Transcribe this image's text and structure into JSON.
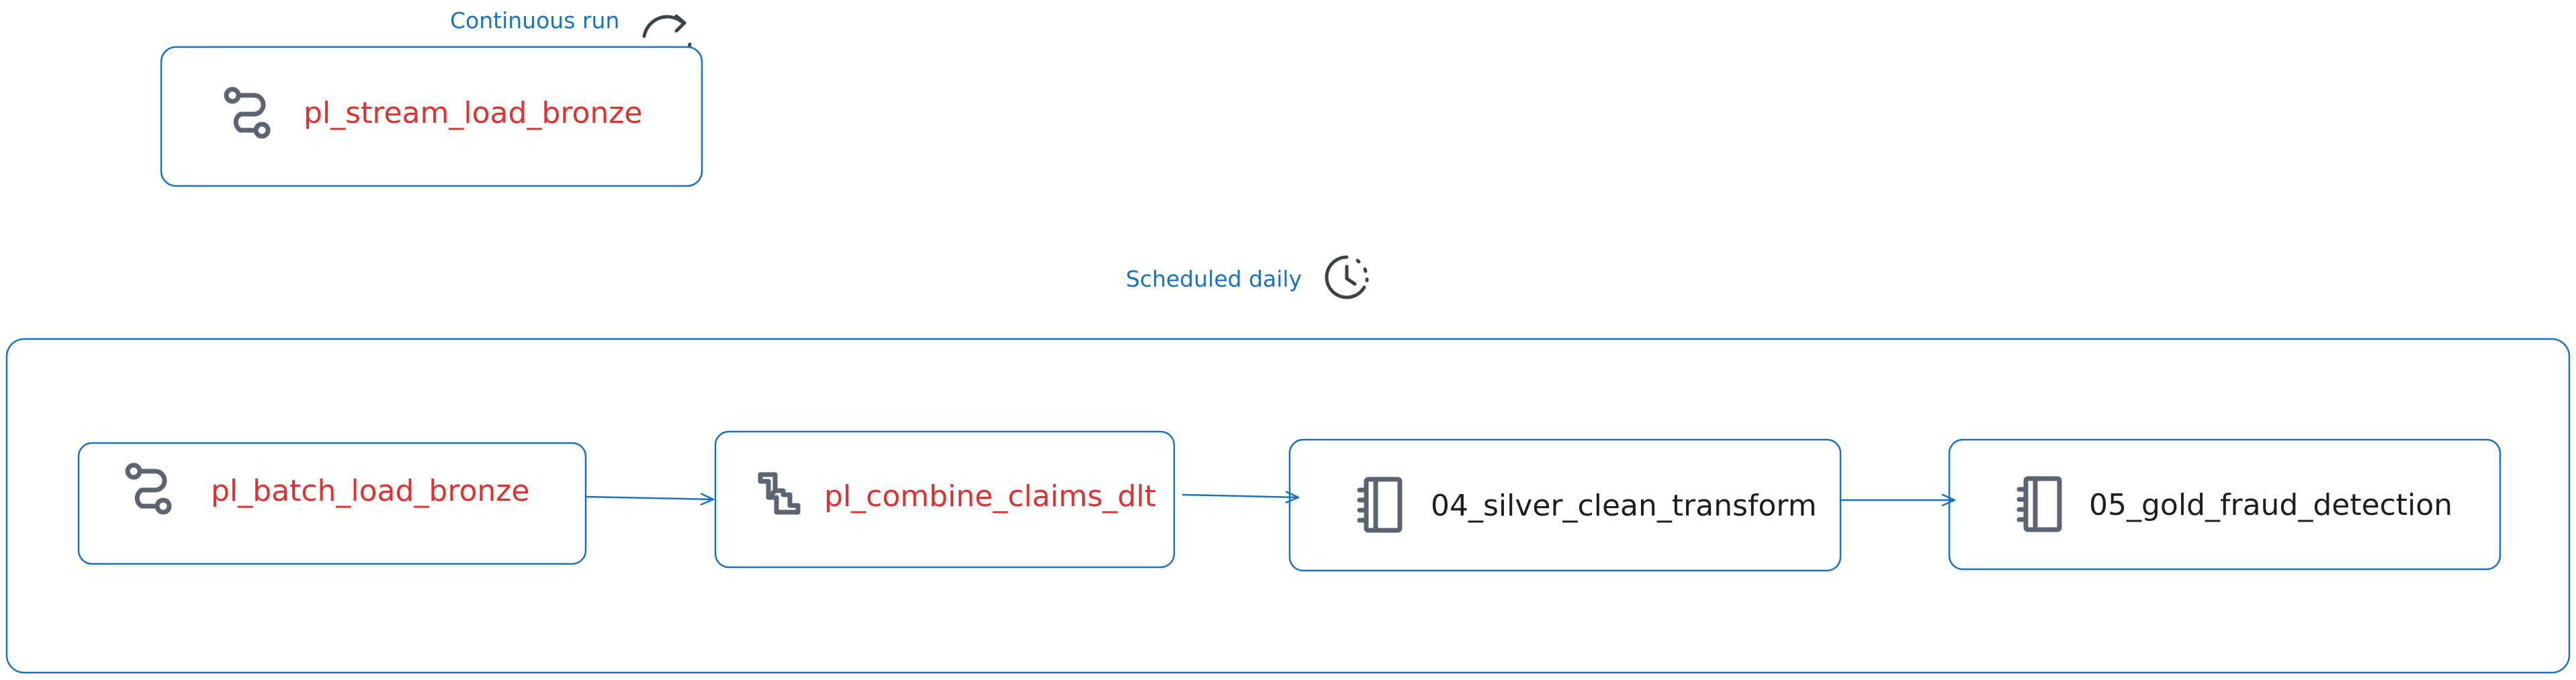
{
  "captions": {
    "continuous": "Continuous run",
    "scheduled": "Scheduled daily"
  },
  "nodes": {
    "stream": {
      "label": "pl_stream_load_bronze",
      "icon": "pipeline-icon"
    },
    "batch": {
      "label": "pl_batch_load_bronze",
      "icon": "pipeline-icon"
    },
    "combine": {
      "label": "pl_combine_claims_dlt",
      "icon": "dlt-pipe-icon"
    },
    "silver": {
      "label": "04_silver_clean_transform",
      "icon": "notebook-icon"
    },
    "gold": {
      "label": "05_gold_fraud_detection",
      "icon": "notebook-icon"
    }
  },
  "icons": {
    "continuous": "refresh-cycle-icon",
    "scheduled": "clock-schedule-icon"
  },
  "colors": {
    "outline": "#1971c2",
    "caption": "#1971c2",
    "pipeline_text": "#e03131",
    "notebook_text": "#1e1e1e",
    "icon": "#5b6470"
  }
}
